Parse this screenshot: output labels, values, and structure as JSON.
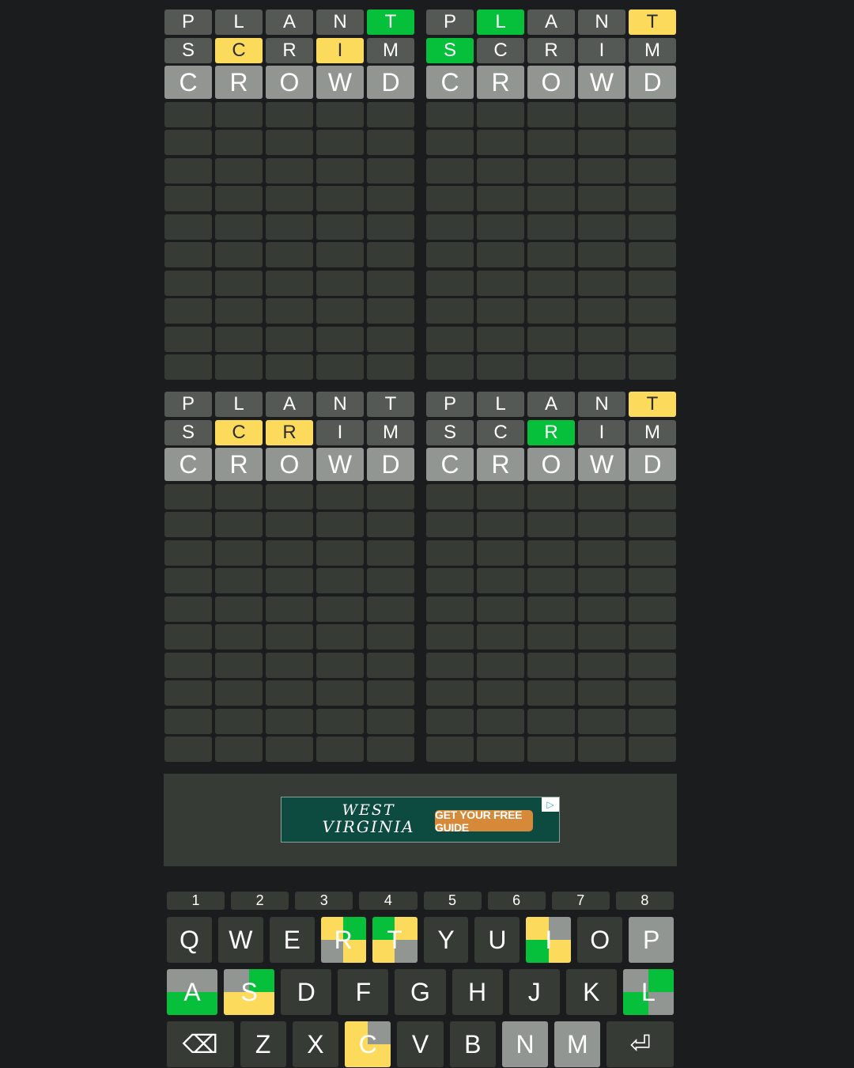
{
  "colors": {
    "background": "#1b1c1e",
    "empty_cell": "#363b35",
    "absent": "#545956",
    "correct": "#06bf3a",
    "present": "#fcda5c",
    "current_guess": "#919693",
    "key_gray": "#919693"
  },
  "boards": [
    {
      "rows": [
        {
          "letters": [
            "P",
            "L",
            "A",
            "N",
            "T"
          ],
          "states": [
            "gray",
            "gray",
            "gray",
            "gray",
            "green"
          ]
        },
        {
          "letters": [
            "S",
            "C",
            "R",
            "I",
            "M"
          ],
          "states": [
            "gray",
            "yellow",
            "gray",
            "yellow",
            "gray"
          ]
        },
        {
          "letters": [
            "C",
            "R",
            "O",
            "W",
            "D"
          ],
          "states": [
            "cur",
            "cur",
            "cur",
            "cur",
            "cur"
          ]
        }
      ]
    },
    {
      "rows": [
        {
          "letters": [
            "P",
            "L",
            "A",
            "N",
            "T"
          ],
          "states": [
            "gray",
            "green",
            "gray",
            "gray",
            "yellow"
          ]
        },
        {
          "letters": [
            "S",
            "C",
            "R",
            "I",
            "M"
          ],
          "states": [
            "green",
            "gray",
            "gray",
            "gray",
            "gray"
          ]
        },
        {
          "letters": [
            "C",
            "R",
            "O",
            "W",
            "D"
          ],
          "states": [
            "cur",
            "cur",
            "cur",
            "cur",
            "cur"
          ]
        }
      ]
    },
    {
      "rows": [
        {
          "letters": [
            "P",
            "L",
            "A",
            "N",
            "T"
          ],
          "states": [
            "gray",
            "gray",
            "gray",
            "gray",
            "gray"
          ]
        },
        {
          "letters": [
            "S",
            "C",
            "R",
            "I",
            "M"
          ],
          "states": [
            "gray",
            "yellow",
            "yellow",
            "gray",
            "gray"
          ]
        },
        {
          "letters": [
            "C",
            "R",
            "O",
            "W",
            "D"
          ],
          "states": [
            "cur",
            "cur",
            "cur",
            "cur",
            "cur"
          ]
        }
      ]
    },
    {
      "rows": [
        {
          "letters": [
            "P",
            "L",
            "A",
            "N",
            "T"
          ],
          "states": [
            "gray",
            "gray",
            "gray",
            "gray",
            "yellow"
          ]
        },
        {
          "letters": [
            "S",
            "C",
            "R",
            "I",
            "M"
          ],
          "states": [
            "gray",
            "gray",
            "green",
            "gray",
            "gray"
          ]
        },
        {
          "letters": [
            "C",
            "R",
            "O",
            "W",
            "D"
          ],
          "states": [
            "cur",
            "cur",
            "cur",
            "cur",
            "cur"
          ]
        }
      ]
    }
  ],
  "ad": {
    "brand_line1": "WEST",
    "brand_line2": "VIRGINIA",
    "cta": "GET YOUR FREE GUIDE",
    "choices_icon": "adchoices-icon"
  },
  "keyboard": {
    "numbers": [
      "1",
      "2",
      "3",
      "4",
      "5",
      "6",
      "7",
      "8"
    ],
    "row1": [
      {
        "k": "Q"
      },
      {
        "k": "W"
      },
      {
        "k": "E"
      },
      {
        "k": "R",
        "q": [
          "yellow",
          "green",
          "gray",
          "yellow"
        ]
      },
      {
        "k": "T",
        "q": [
          "green",
          "yellow",
          "yellow",
          "gray"
        ]
      },
      {
        "k": "Y"
      },
      {
        "k": "U"
      },
      {
        "k": "I",
        "q": [
          "yellow",
          "gray",
          "green",
          "yellow"
        ]
      },
      {
        "k": "O"
      },
      {
        "k": "P",
        "gray": true
      }
    ],
    "row2": [
      {
        "k": "A",
        "q": [
          "gray",
          "gray",
          "green",
          "green"
        ]
      },
      {
        "k": "S",
        "q": [
          "gray",
          "green",
          "yellow",
          "yellow"
        ]
      },
      {
        "k": "D"
      },
      {
        "k": "F"
      },
      {
        "k": "G"
      },
      {
        "k": "H"
      },
      {
        "k": "J"
      },
      {
        "k": "K"
      },
      {
        "k": "L",
        "q": [
          "gray",
          "green",
          "green",
          "gray"
        ]
      }
    ],
    "row3": [
      {
        "k": "⌫",
        "wide": true,
        "name": "backspace-key"
      },
      {
        "k": "Z"
      },
      {
        "k": "X"
      },
      {
        "k": "C",
        "q": [
          "yellow",
          "gray",
          "yellow",
          "yellow"
        ]
      },
      {
        "k": "V"
      },
      {
        "k": "B"
      },
      {
        "k": "N",
        "gray": true
      },
      {
        "k": "M",
        "gray": true
      },
      {
        "k": "⏎",
        "wide": true,
        "name": "enter-key"
      }
    ]
  }
}
